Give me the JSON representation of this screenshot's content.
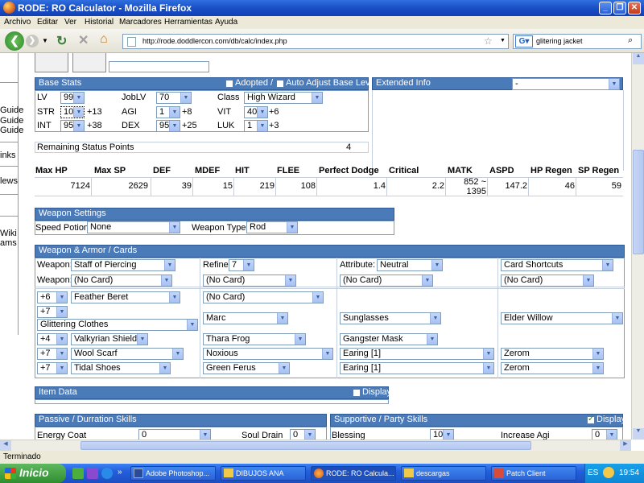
{
  "window": {
    "title": "RODE: RO Calculator - Mozilla Firefox"
  },
  "menu": [
    "Archivo",
    "Editar",
    "Ver",
    "Historial",
    "Marcadores",
    "Herramientas",
    "Ayuda"
  ],
  "toolbar": {
    "url": "http://rode.doddlercon.com/db/calc/index.php",
    "search": "glitering jacket"
  },
  "sidebar": {
    "items": [
      "Guide",
      "Guide",
      "Guide",
      "inks",
      "lews",
      "Wiki",
      "ams"
    ]
  },
  "base_stats": {
    "title": "Base Stats",
    "adopted_label": "Adopted /",
    "auto_adjust_label": "Auto Adjust Base Level",
    "lv_label": "LV",
    "lv": "99",
    "joblv_label": "JobLV",
    "joblv": "70",
    "class_label": "Class",
    "class": "High Wizard",
    "str_label": "STR",
    "str": "10",
    "str_bonus": "+13",
    "agi_label": "AGI",
    "agi": "1",
    "agi_bonus": "+8",
    "vit_label": "VIT",
    "vit": "40",
    "vit_bonus": "+6",
    "int_label": "INT",
    "int": "95",
    "int_bonus": "+38",
    "dex_label": "DEX",
    "dex": "95",
    "dex_bonus": "+25",
    "luk_label": "LUK",
    "luk": "1",
    "luk_bonus": "+3"
  },
  "extended": {
    "title": "Extended Info",
    "value": "-"
  },
  "remaining": {
    "label": "Remaining Status Points",
    "value": "4"
  },
  "stats_headers": [
    "Max HP",
    "Max SP",
    "DEF",
    "MDEF",
    "HIT",
    "FLEE",
    "Perfect Dodge",
    "Critical",
    "MATK",
    "ASPD",
    "HP Regen",
    "SP Regen"
  ],
  "stats_values": [
    "7124",
    "2629",
    "39",
    "15",
    "219",
    "108",
    "1.4",
    "2.2",
    "852 ~",
    "147.2",
    "46",
    "59"
  ],
  "matk_second": "1395",
  "weapon_settings": {
    "title": "Weapon Settings",
    "potion_label": "Speed Potion:",
    "potion": "None",
    "type_label": "Weapon Type:",
    "type": "Rod"
  },
  "armor": {
    "title": "Weapon & Armor / Cards",
    "weapon_label": "Weapon:",
    "weapon": "Staff of Piercing",
    "refine_label": "Refine:",
    "refine": "7",
    "attribute_label": "Attribute:",
    "attribute": "Neutral",
    "card_shortcuts": "Card Shortcuts",
    "weapon2_label": "Weapon:",
    "weapon_card1": "(No Card)",
    "weapon_card2": "(No Card)",
    "weapon_card3": "(No Card)",
    "weapon_card4": "(No Card)",
    "rows": [
      {
        "refine": "+6",
        "item": "Feather Beret",
        "card": "(No Card)"
      },
      {
        "refine": "+7",
        "item": "Glittering Clothes",
        "card": "Marc",
        "mid": "Sunglasses",
        "lower": "Elder Willow"
      },
      {
        "refine": "+4",
        "item": "Valkyrian Shield",
        "card": "Thara Frog",
        "mid": "Gangster Mask"
      },
      {
        "refine": "+7",
        "item": "Wool Scarf",
        "card": "Noxious",
        "acc": "Earing [1]",
        "acc_card": "Zerom"
      },
      {
        "refine": "+7",
        "item": "Tidal Shoes",
        "card": "Green Ferus",
        "acc": "Earing [1]",
        "acc_card": "Zerom"
      }
    ]
  },
  "item_data": {
    "title": "Item Data",
    "display": "Display"
  },
  "passive": {
    "title": "Passive / Durration Skills",
    "skill1": "Energy Coat",
    "skill1_val": "0",
    "skill2": "Soul Drain",
    "skill2_val": "0"
  },
  "supportive": {
    "title": "Supportive / Party Skills",
    "display": "Display",
    "skill1": "Blessing",
    "skill1_val": "10",
    "skill2": "Increase Agi",
    "skill2_val": "0"
  },
  "statusbar": "Terminado",
  "taskbar": {
    "start": "Inicio",
    "tasks": [
      "Adobe Photoshop...",
      "DIBUJOS ANA",
      "RODE: RO Calcula...",
      "descargas",
      "Patch Client"
    ],
    "lang": "ES",
    "time": "19:54"
  }
}
